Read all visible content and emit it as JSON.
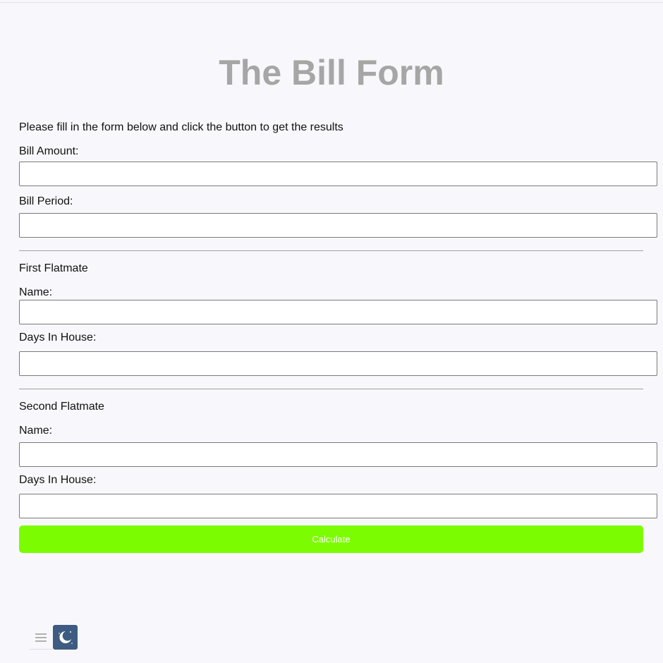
{
  "page": {
    "title": "The Bill Form",
    "intro": "Please fill in the form below and click the button to get the results"
  },
  "bill": {
    "amount_label": "Bill Amount:",
    "amount_value": "",
    "period_label": "Bill Period:",
    "period_value": ""
  },
  "flatmate1": {
    "section_title": "First Flatmate",
    "name_label": "Name:",
    "name_value": "",
    "days_label": "Days In House:",
    "days_value": ""
  },
  "flatmate2": {
    "section_title": "Second Flatmate",
    "name_label": "Name:",
    "name_value": "",
    "days_label": "Days In House:",
    "days_value": ""
  },
  "actions": {
    "calculate_label": "Calculate"
  },
  "colors": {
    "background": "#f8f8fc",
    "title": "#a6a6a6",
    "button": "#7cfc00",
    "theme_toggle": "#3e5c82"
  },
  "icons": {
    "menu": "hamburger-menu-icon",
    "theme": "moon-icon"
  }
}
